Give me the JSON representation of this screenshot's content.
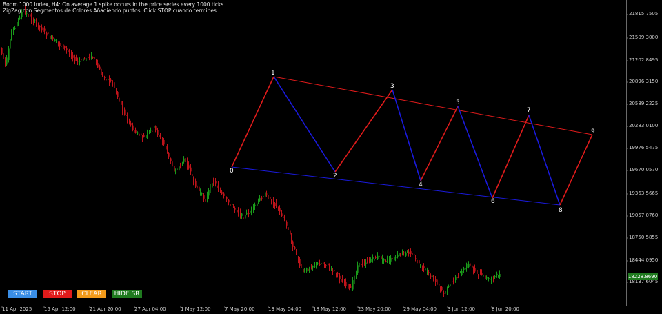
{
  "header": {
    "line1": "Boom 1000 Index, H4:  On average 1 spike occurs in the price series every 1000 ticks",
    "line2": "ZigZag con Segmentos de Colores  Añadiendo puntos. Click STOP cuando termines"
  },
  "buttons": [
    {
      "label": "START",
      "bg": "#3a8ee6",
      "fg": "#ffffff"
    },
    {
      "label": "STOP",
      "bg": "#e01b1b",
      "fg": "#ffffff"
    },
    {
      "label": "CLEAR",
      "bg": "#f29a1a",
      "fg": "#ffffff"
    },
    {
      "label": "HIDE SR",
      "bg": "#1f7a1f",
      "fg": "#ffffff"
    }
  ],
  "price_axis": [
    "21815.7505",
    "21509.3000",
    "21202.8495",
    "20896.3150",
    "20589.2225",
    "20283.0100",
    "19976.5475",
    "19670.0570",
    "19363.5665",
    "19057.0760",
    "18750.5855",
    "18444.0950",
    "18137.6045"
  ],
  "current_price": "18228.8690",
  "time_axis": [
    "11 Apr 2025",
    "15 Apr 12:00",
    "21 Apr 20:00",
    "27 Apr 04:00",
    "1 May 12:00",
    "7 May 20:00",
    "13 May 04:00",
    "18 May 12:00",
    "23 May 20:00",
    "29 May 04:00",
    "3 Jun 12:00",
    "8 Jun 20:00"
  ],
  "zigzag_labels": [
    "0",
    "1",
    "2",
    "3",
    "4",
    "5",
    "6",
    "7",
    "8",
    "9"
  ],
  "colors": {
    "up": "#e01b1b",
    "down": "#1a1adc",
    "bull": "#1a9a1a",
    "bear": "#c0141b",
    "level": "#1f6a1f"
  }
}
